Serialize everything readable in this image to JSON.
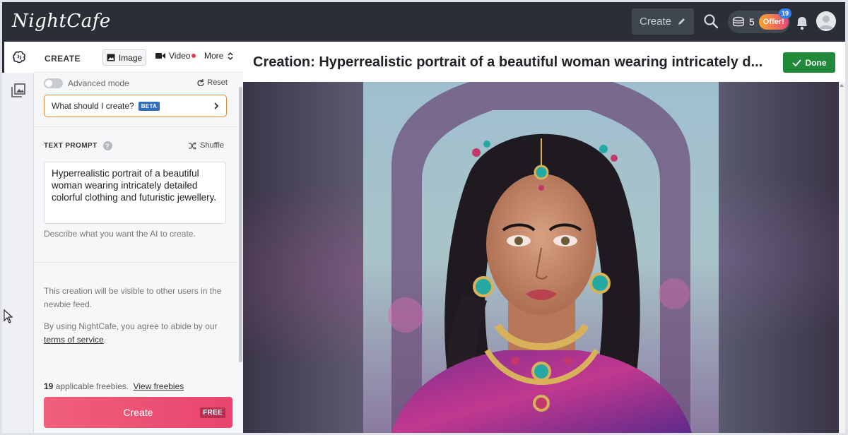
{
  "app": {
    "logo_text": "NightCafe"
  },
  "topbar": {
    "create_label": "Create",
    "coins_count": "5",
    "offer_label": "Offer!",
    "offer_badge": "19"
  },
  "panel": {
    "tabs": {
      "create_label": "CREATE",
      "image_label": "Image",
      "video_label": "Video",
      "more_label": "More"
    },
    "advanced_mode_label": "Advanced mode",
    "advanced_mode_on": false,
    "reset_label": "Reset",
    "what_should_label": "What should I create?",
    "beta_label": "BETA",
    "text_prompt_label": "TEXT PROMPT",
    "shuffle_label": "Shuffle",
    "prompt_value": "Hyperrealistic portrait of a beautiful woman wearing intricately detailed colorful clothing and futuristic jewellery.",
    "prompt_hint": "Describe what you want the AI to create.",
    "visibility_note": "This creation will be visible to other users in the newbie feed.",
    "terms_prefix": "By using NightCafe, you agree to abide by our",
    "terms_link": "terms of service",
    "terms_suffix": ".",
    "freebies_count": "19",
    "freebies_text": "applicable freebies.",
    "view_freebies_label": "View freebies",
    "create_button_label": "Create",
    "free_badge": "FREE"
  },
  "main": {
    "title": "Creation: Hyperrealistic portrait of a beautiful woman wearing intricately d...",
    "done_label": "Done"
  },
  "colors": {
    "topbar_bg": "#2a2f37",
    "create_button": "#ec5275",
    "done_button": "#218a3a",
    "beta_badge": "#2f6ec3",
    "what_box_border": "#e6893a"
  },
  "icons": {
    "rail": [
      "brain-icon",
      "gallery-icon"
    ],
    "topbar": [
      "pencil-icon",
      "search-icon",
      "coins-icon",
      "bell-icon",
      "avatar-icon"
    ]
  }
}
